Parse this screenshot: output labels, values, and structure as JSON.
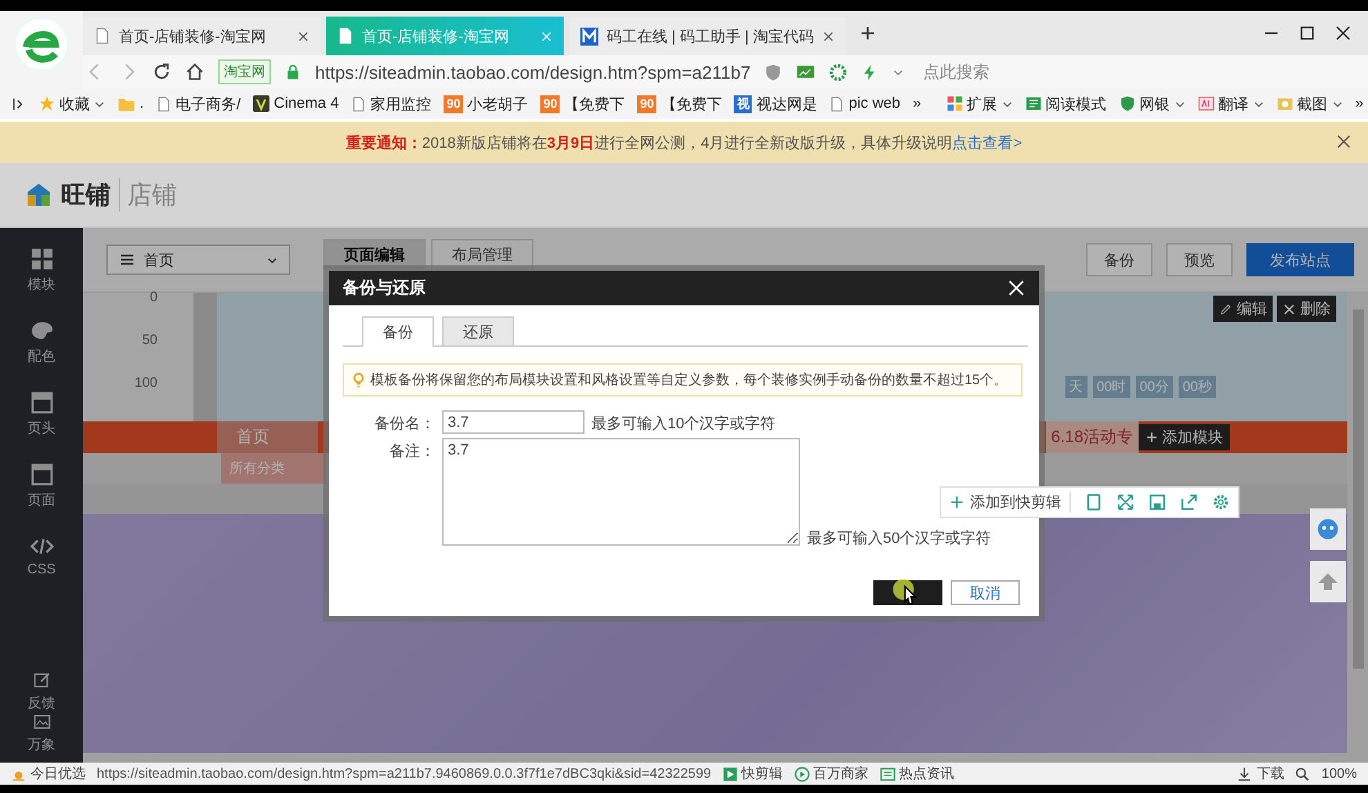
{
  "browser": {
    "tabs": [
      {
        "title": "首页-店铺装修-淘宝网",
        "selected": false
      },
      {
        "title": "首页-店铺装修-淘宝网",
        "selected": true
      },
      {
        "title": "码工在线 | 码工助手 | 淘宝代码",
        "selected": false
      }
    ],
    "address_bar": {
      "site_badge": "淘宝网",
      "url": "https://siteadmin.taobao.com/design.htm?spm=a211b7",
      "search_placeholder": "点此搜索"
    },
    "bookmarks": [
      {
        "label": "收藏",
        "kind": "star"
      },
      {
        "label": ".",
        "kind": "folder"
      },
      {
        "label": "电子商务/",
        "kind": "page"
      },
      {
        "label": "Cinema 4",
        "kind": "app"
      },
      {
        "label": "家用监控",
        "kind": "page"
      },
      {
        "label": "小老胡子",
        "kind": "badge",
        "badge": "90",
        "color": "#f07a2a"
      },
      {
        "label": "【免费下",
        "kind": "badge",
        "badge": "90",
        "color": "#f07a2a"
      },
      {
        "label": "【免费下",
        "kind": "badge",
        "badge": "90",
        "color": "#f07a2a"
      },
      {
        "label": "视达网是",
        "kind": "badge",
        "badge": "视",
        "color": "#2a6fc9"
      },
      {
        "label": "pic web",
        "kind": "page"
      }
    ],
    "bookmarks_more": "»",
    "extensions": [
      {
        "label": "扩展"
      },
      {
        "label": "阅读模式"
      },
      {
        "label": "网银"
      },
      {
        "label": "翻译"
      },
      {
        "label": "截图"
      }
    ],
    "extensions_more": "»"
  },
  "notice": {
    "label": "重要通知：",
    "text": "2018新版店铺将在**3月9日**进行全网公测，4月进行全新改版升级，具体升级说明",
    "link": "点击查看>"
  },
  "app_header": {
    "logo": "旺铺",
    "section": "店铺"
  },
  "sidebar": [
    {
      "label": "模块"
    },
    {
      "label": "配色"
    },
    {
      "label": "页头"
    },
    {
      "label": "页面"
    },
    {
      "label": "CSS"
    },
    {
      "label": "反馈"
    },
    {
      "label": "万象"
    }
  ],
  "toolbar": {
    "page_select": "首页",
    "tabs": [
      {
        "label": "页面编辑",
        "selected": true
      },
      {
        "label": "布局管理",
        "selected": false
      }
    ],
    "buttons": [
      {
        "label": "备份",
        "kind": "default"
      },
      {
        "label": "预览",
        "kind": "default"
      },
      {
        "label": "发布站点",
        "kind": "primary"
      }
    ]
  },
  "canvas": {
    "ruler": [
      "0",
      "50",
      "100"
    ],
    "module_actions": [
      {
        "label": "编辑"
      },
      {
        "label": "删除"
      }
    ],
    "countdown": [
      "天",
      "00时",
      "00分",
      "00秒"
    ],
    "nav_item": "首页",
    "promo_title": "6.18活动专",
    "add_module": "添加模块",
    "category": "所有分类"
  },
  "dialog": {
    "title": "备份与还原",
    "tabs": [
      {
        "label": "备份",
        "selected": true
      },
      {
        "label": "还原",
        "selected": false
      }
    ],
    "info": "模板备份将保留您的布局模块设置和风格设置等自定义参数，每个装修实例手动备份的数量不超过15个。",
    "name_field": {
      "label": "备份名：",
      "value": "3.7",
      "hint": "最多可输入10个汉字或字符"
    },
    "note_field": {
      "label": "备注：",
      "value": "3.7",
      "hint": "最多可输入50个汉字或字符"
    },
    "cancel": "取消"
  },
  "quick_toolbar": {
    "label": "添加到快剪辑"
  },
  "status_bar": {
    "left": "今日优选",
    "url": "https://siteadmin.taobao.com/design.htm?spm=a211b7.9460869.0.0.3f7f1e7dBC3qki&sid=42322599",
    "items": [
      "快剪辑",
      "百万商家",
      "热点资讯",
      "下载"
    ],
    "zoom": "100%"
  }
}
